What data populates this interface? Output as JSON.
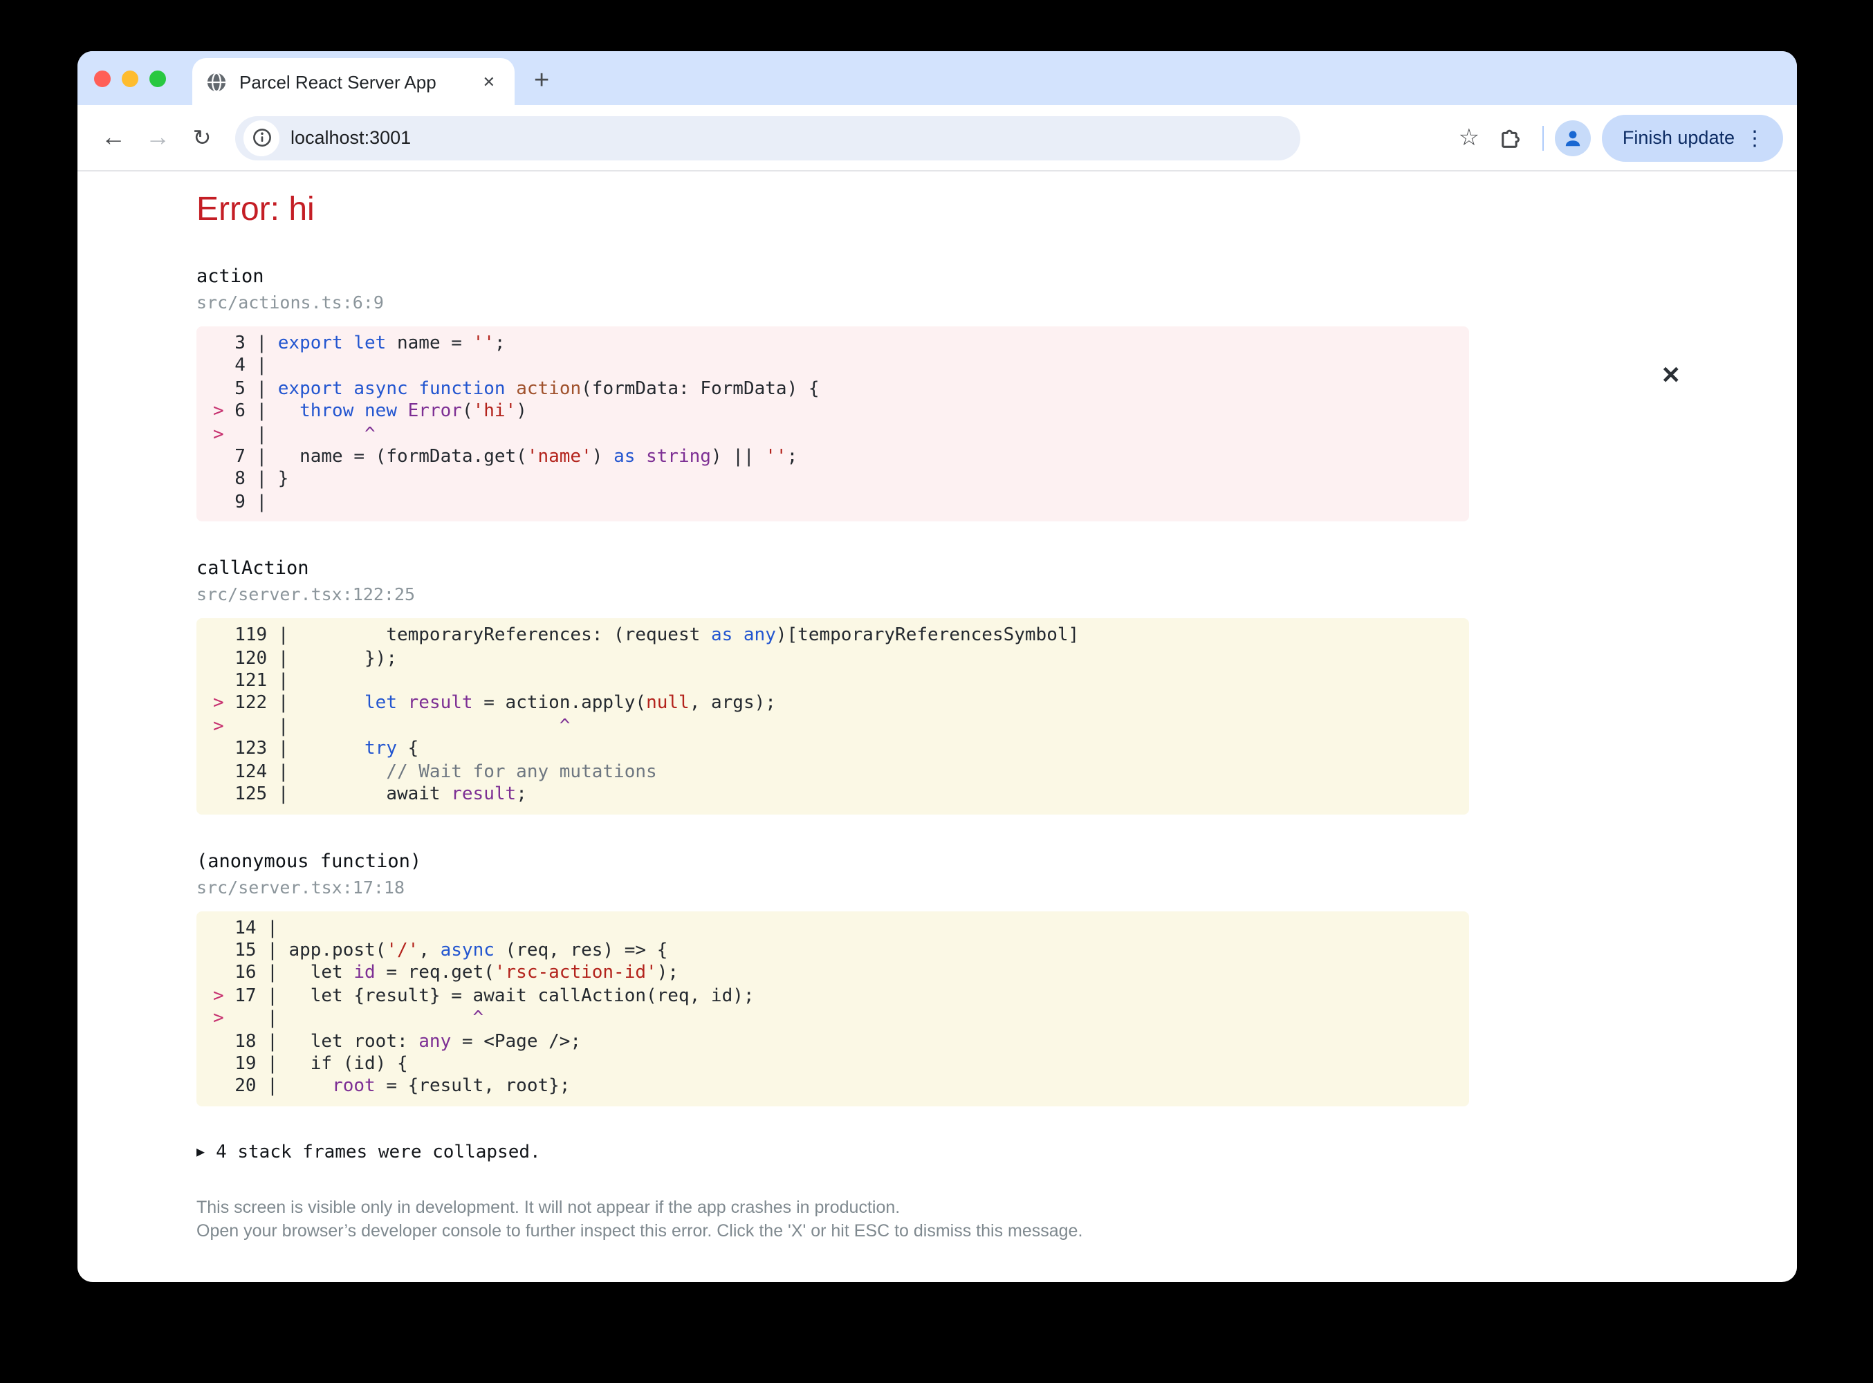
{
  "browser": {
    "traffic_lights": [
      "#ff5f57",
      "#febc2e",
      "#28c840"
    ],
    "tab": {
      "title": "Parcel React Server App",
      "close_icon": "✕",
      "new_tab_icon": "+",
      "favicon": "globe-icon"
    },
    "toolbar": {
      "back_icon": "←",
      "forward_icon": "→",
      "reload_icon": "↻",
      "info_icon": "site-info-icon",
      "url": "localhost:3001",
      "star_icon": "☆",
      "extensions_icon": "puzzle-icon",
      "profile_icon": "person-icon",
      "update_button": "Finish update",
      "menu_icon": "⋮"
    }
  },
  "overlay": {
    "title": "Error: hi",
    "close_icon": "✕",
    "collapsed": {
      "icon": "▶",
      "text": "4 stack frames were collapsed."
    },
    "footer": [
      "This screen is visible only in development. It will not appear if the app crashes in production.",
      "Open your browser’s developer console to further inspect this error.  Click the 'X' or hit ESC to dismiss this message."
    ],
    "frames": [
      {
        "name": "action",
        "location": "src/actions.ts:6:9",
        "variant": "pink",
        "numw": 1,
        "lines": [
          {
            "m": "",
            "n": "3",
            "s": [
              [
                "k",
                "export"
              ],
              [
                "p",
                " "
              ],
              [
                "k",
                "let"
              ],
              [
                "p",
                " name = "
              ],
              [
                "s",
                "''"
              ],
              [
                "p",
                ";"
              ]
            ]
          },
          {
            "m": "",
            "n": "4",
            "s": []
          },
          {
            "m": "",
            "n": "5",
            "s": [
              [
                "k",
                "export"
              ],
              [
                "p",
                " "
              ],
              [
                "k",
                "async"
              ],
              [
                "p",
                " "
              ],
              [
                "k",
                "function"
              ],
              [
                "p",
                " "
              ],
              [
                "fn",
                "action"
              ],
              [
                "p",
                "(formData: FormData) {"
              ]
            ]
          },
          {
            "m": ">",
            "n": "6",
            "s": [
              [
                "p",
                "  "
              ],
              [
                "k",
                "throw"
              ],
              [
                "p",
                " "
              ],
              [
                "k",
                "new"
              ],
              [
                "p",
                " "
              ],
              [
                "t",
                "Error"
              ],
              [
                "p",
                "("
              ],
              [
                "s",
                "'hi'"
              ],
              [
                "p",
                ")"
              ]
            ]
          },
          {
            "m": ">",
            "n": "",
            "s": [
              [
                "t",
                "        ^"
              ]
            ]
          },
          {
            "m": "",
            "n": "7",
            "s": [
              [
                "p",
                "  name = (formData.get("
              ],
              [
                "s",
                "'name'"
              ],
              [
                "p",
                ") "
              ],
              [
                "k",
                "as"
              ],
              [
                "p",
                " "
              ],
              [
                "t",
                "string"
              ],
              [
                "p",
                ") || "
              ],
              [
                "s",
                "''"
              ],
              [
                "p",
                ";"
              ]
            ]
          },
          {
            "m": "",
            "n": "8",
            "s": [
              [
                "p",
                "}"
              ]
            ]
          },
          {
            "m": "",
            "n": "9",
            "s": []
          }
        ]
      },
      {
        "name": "callAction",
        "location": "src/server.tsx:122:25",
        "variant": "yellow",
        "numw": 3,
        "lines": [
          {
            "m": "",
            "n": "119",
            "s": [
              [
                "p",
                "        temporaryReferences: (request "
              ],
              [
                "k",
                "as"
              ],
              [
                "p",
                " "
              ],
              [
                "k",
                "any"
              ],
              [
                "p",
                ")[temporaryReferencesSymbol]"
              ]
            ]
          },
          {
            "m": "",
            "n": "120",
            "s": [
              [
                "p",
                "      });"
              ]
            ]
          },
          {
            "m": "",
            "n": "121",
            "s": []
          },
          {
            "m": ">",
            "n": "122",
            "s": [
              [
                "p",
                "      "
              ],
              [
                "k",
                "let"
              ],
              [
                "p",
                " "
              ],
              [
                "t",
                "result"
              ],
              [
                "p",
                " = action.apply("
              ],
              [
                "s",
                "null"
              ],
              [
                "p",
                ", args);"
              ]
            ]
          },
          {
            "m": ">",
            "n": "",
            "s": [
              [
                "t",
                "                        ^"
              ]
            ]
          },
          {
            "m": "",
            "n": "123",
            "s": [
              [
                "p",
                "      "
              ],
              [
                "k",
                "try"
              ],
              [
                "p",
                " {"
              ]
            ]
          },
          {
            "m": "",
            "n": "124",
            "s": [
              [
                "c",
                "        // Wait for any mutations"
              ]
            ]
          },
          {
            "m": "",
            "n": "125",
            "s": [
              [
                "p",
                "        await "
              ],
              [
                "t",
                "result"
              ],
              [
                "p",
                ";"
              ]
            ]
          }
        ]
      },
      {
        "name": "(anonymous function)",
        "location": "src/server.tsx:17:18",
        "variant": "yellow",
        "numw": 2,
        "lines": [
          {
            "m": "",
            "n": "14",
            "s": []
          },
          {
            "m": "",
            "n": "15",
            "s": [
              [
                "p",
                "app.post("
              ],
              [
                "s",
                "'/'"
              ],
              [
                "p",
                ", "
              ],
              [
                "k",
                "async"
              ],
              [
                "p",
                " (req, res) => {"
              ]
            ]
          },
          {
            "m": "",
            "n": "16",
            "s": [
              [
                "p",
                "  let "
              ],
              [
                "t",
                "id"
              ],
              [
                "p",
                " = req.get("
              ],
              [
                "s",
                "'rsc-action-id'"
              ],
              [
                "p",
                ");"
              ]
            ]
          },
          {
            "m": ">",
            "n": "17",
            "s": [
              [
                "p",
                "  let {result} = await callAction(req, id);"
              ]
            ]
          },
          {
            "m": ">",
            "n": "",
            "s": [
              [
                "t",
                "                 ^"
              ]
            ]
          },
          {
            "m": "",
            "n": "18",
            "s": [
              [
                "p",
                "  let root: "
              ],
              [
                "t",
                "any"
              ],
              [
                "p",
                " = <Page />;"
              ]
            ]
          },
          {
            "m": "",
            "n": "19",
            "s": [
              [
                "p",
                "  if (id) {"
              ]
            ]
          },
          {
            "m": "",
            "n": "20",
            "s": [
              [
                "p",
                "    "
              ],
              [
                "t",
                "root"
              ],
              [
                "p",
                " = {result, root};"
              ]
            ]
          }
        ]
      }
    ]
  },
  "colors": {
    "error_title": "#c41e25",
    "frame_path": "#8b959b",
    "marker": "#c73270",
    "keyword": "#2356d0",
    "identifier_purple": "#7d2f94",
    "string_red": "#b3231c",
    "function_brown": "#a0522d",
    "comment_gray": "#6e7781",
    "block_pink_bg": "#fdf1f2",
    "block_yellow_bg": "#fbf8e5",
    "tabstrip_bg": "#d3e3fd",
    "omnibox_bg": "#e9eef8",
    "update_pill_bg": "#c9dcfb",
    "update_pill_text": "#0d2c64"
  }
}
